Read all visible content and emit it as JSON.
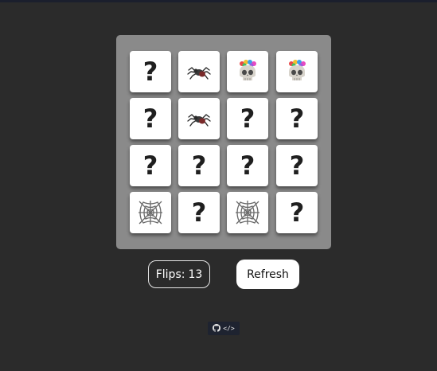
{
  "board": {
    "cards": [
      {
        "face": "hidden",
        "symbol": "?",
        "icon": "question-mark"
      },
      {
        "face": "revealed",
        "symbol": "",
        "icon": "spider"
      },
      {
        "face": "revealed",
        "symbol": "",
        "icon": "skull-with-flowers"
      },
      {
        "face": "revealed",
        "symbol": "",
        "icon": "skull-with-flowers"
      },
      {
        "face": "hidden",
        "symbol": "?",
        "icon": "question-mark"
      },
      {
        "face": "revealed",
        "symbol": "",
        "icon": "spider"
      },
      {
        "face": "hidden",
        "symbol": "?",
        "icon": "question-mark"
      },
      {
        "face": "hidden",
        "symbol": "?",
        "icon": "question-mark"
      },
      {
        "face": "hidden",
        "symbol": "?",
        "icon": "question-mark"
      },
      {
        "face": "hidden",
        "symbol": "?",
        "icon": "question-mark"
      },
      {
        "face": "hidden",
        "symbol": "?",
        "icon": "question-mark"
      },
      {
        "face": "hidden",
        "symbol": "?",
        "icon": "question-mark"
      },
      {
        "face": "revealed",
        "symbol": "",
        "icon": "spider-web"
      },
      {
        "face": "hidden",
        "symbol": "?",
        "icon": "question-mark"
      },
      {
        "face": "revealed",
        "symbol": "",
        "icon": "spider-web"
      },
      {
        "face": "hidden",
        "symbol": "?",
        "icon": "question-mark"
      }
    ]
  },
  "stats": {
    "flips_label": "Flips:",
    "flips_count": "13"
  },
  "controls": {
    "refresh_label": "Refresh"
  },
  "footer": {
    "code_label": "</>",
    "icon": "github-icon"
  },
  "colors": {
    "background": "#2b2b2b",
    "board": "#8a8a8a",
    "card": "#ffffff",
    "badge": "#1e2330"
  }
}
